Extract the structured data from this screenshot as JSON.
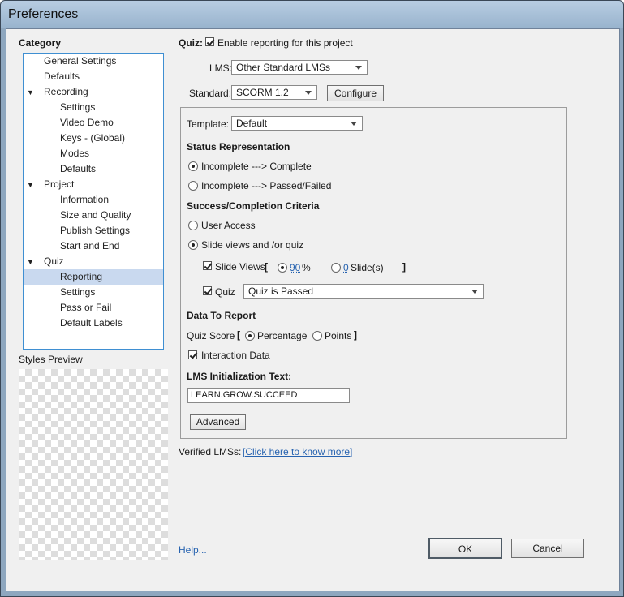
{
  "window": {
    "title": "Preferences"
  },
  "sidebar": {
    "category_label": "Category",
    "items": [
      {
        "label": "General Settings"
      },
      {
        "label": "Defaults"
      },
      {
        "label": "Recording"
      },
      {
        "label": "Settings"
      },
      {
        "label": "Video Demo"
      },
      {
        "label": "Keys - (Global)"
      },
      {
        "label": "Modes"
      },
      {
        "label": "Defaults"
      },
      {
        "label": "Project"
      },
      {
        "label": "Information"
      },
      {
        "label": "Size and Quality"
      },
      {
        "label": "Publish Settings"
      },
      {
        "label": "Start and End"
      },
      {
        "label": "Quiz"
      },
      {
        "label": "Reporting"
      },
      {
        "label": "Settings"
      },
      {
        "label": "Pass or Fail"
      },
      {
        "label": "Default Labels"
      }
    ],
    "selected_item": "Reporting",
    "styles_preview_label": "Styles Preview"
  },
  "main": {
    "quiz_label": "Quiz:",
    "enable_reporting": {
      "label": "Enable reporting for this project",
      "checked": true
    },
    "lms": {
      "label": "LMS:",
      "value": "Other Standard LMSs"
    },
    "standard": {
      "label": "Standard:",
      "value": "SCORM 1.2"
    },
    "configure_label": "Configure",
    "template": {
      "label": "Template:",
      "value": "Default"
    },
    "status_representation": {
      "heading": "Status Representation",
      "option1": "Incomplete ---> Complete",
      "option2": "Incomplete ---> Passed/Failed",
      "selected": "Incomplete ---> Complete"
    },
    "success_criteria": {
      "heading": "Success/Completion Criteria",
      "user_access": "User Access",
      "slide_views_quiz": "Slide views and /or quiz",
      "selected": "Slide views and /or quiz",
      "slide_views_label": "Slide Views",
      "bracket_open": "[",
      "bracket_close": "]",
      "percent_value": "90",
      "percent_unit": "%",
      "slides_value": "0",
      "slides_unit": "Slide(s)",
      "quiz_label": "Quiz",
      "quiz_value": "Quiz is Passed"
    },
    "data_to_report": {
      "heading": "Data To Report",
      "quiz_score_label": "Quiz Score",
      "bracket_open": "[",
      "bracket_close": "]",
      "percentage": "Percentage",
      "points": "Points",
      "selected": "Percentage",
      "interaction_data": "Interaction Data"
    },
    "lms_init": {
      "heading": "LMS Initialization Text:",
      "value": "LEARN.GROW.SUCCEED"
    },
    "advanced_label": "Advanced",
    "verified_lms_label": "Verified LMSs:",
    "verified_lms_link": "[Click here to know more]"
  },
  "footer": {
    "help_label": "Help...",
    "ok_label": "OK",
    "cancel_label": "Cancel"
  },
  "colors": {
    "accent": "#3f8fd2",
    "selected_bg": "#c9d9ef",
    "link": "#2763b0"
  }
}
